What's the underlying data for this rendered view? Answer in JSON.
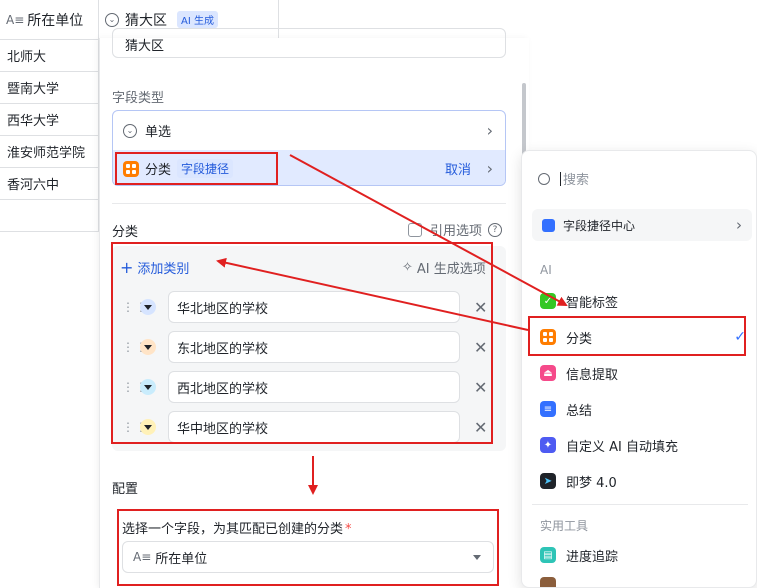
{
  "table": {
    "col1_header": "所在单位",
    "col1_icon": "text-field-icon",
    "col2_header": "猜大区",
    "col2_badge": "AI 生成",
    "rows": [
      "北师大",
      "暨南大学",
      "西华大学",
      "淮安师范学院",
      "香河六中"
    ]
  },
  "panel": {
    "title_partial": "猜大区",
    "field_type_label": "字段类型",
    "type_single": "单选",
    "type_category": "分类",
    "type_category_tag": "字段捷径",
    "cancel_label": "取消",
    "category_label": "分类",
    "ref_options_label": "引用选项",
    "add_category_label": "添加类别",
    "ai_generate_label": "AI 生成选项",
    "options": [
      {
        "label": "华北地区的学校",
        "color": "#d6e4ff"
      },
      {
        "label": "东北地区的学校",
        "color": "#ffe4c7"
      },
      {
        "label": "西北地区的学校",
        "color": "#c9ecfc"
      },
      {
        "label": "华中地区的学校",
        "color": "#fff1b8"
      }
    ],
    "config_label": "配置",
    "match_label": "选择一个字段，为其匹配已创建的分类",
    "required_mark": "*",
    "match_value": "所在单位"
  },
  "dropdown": {
    "search_placeholder": "搜索",
    "shortcut_center": "字段捷径中心",
    "group_ai": "AI",
    "ai_items": [
      {
        "label": "智能标签",
        "icon": "tag-icon",
        "color": "#34c724"
      },
      {
        "label": "分类",
        "icon": "category-icon",
        "color": "#ff7d00",
        "selected": true
      },
      {
        "label": "信息提取",
        "icon": "extract-icon",
        "color": "#f54a8a"
      },
      {
        "label": "总结",
        "icon": "summary-icon",
        "color": "#3370ff"
      },
      {
        "label": "自定义 AI 自动填充",
        "icon": "sparkle-icon",
        "color": "#4e5bf2"
      },
      {
        "label": "即梦 4.0",
        "icon": "jimeng-icon",
        "color": "#1f2329"
      }
    ],
    "group_tools": "实用工具",
    "tool_items": [
      {
        "label": "进度追踪",
        "icon": "progress-icon",
        "color": "#2ec4b6"
      }
    ]
  },
  "colors": {
    "accent": "#3370ff",
    "annotation_red": "#e02020",
    "selected_row_bg": "#e1eaff"
  }
}
